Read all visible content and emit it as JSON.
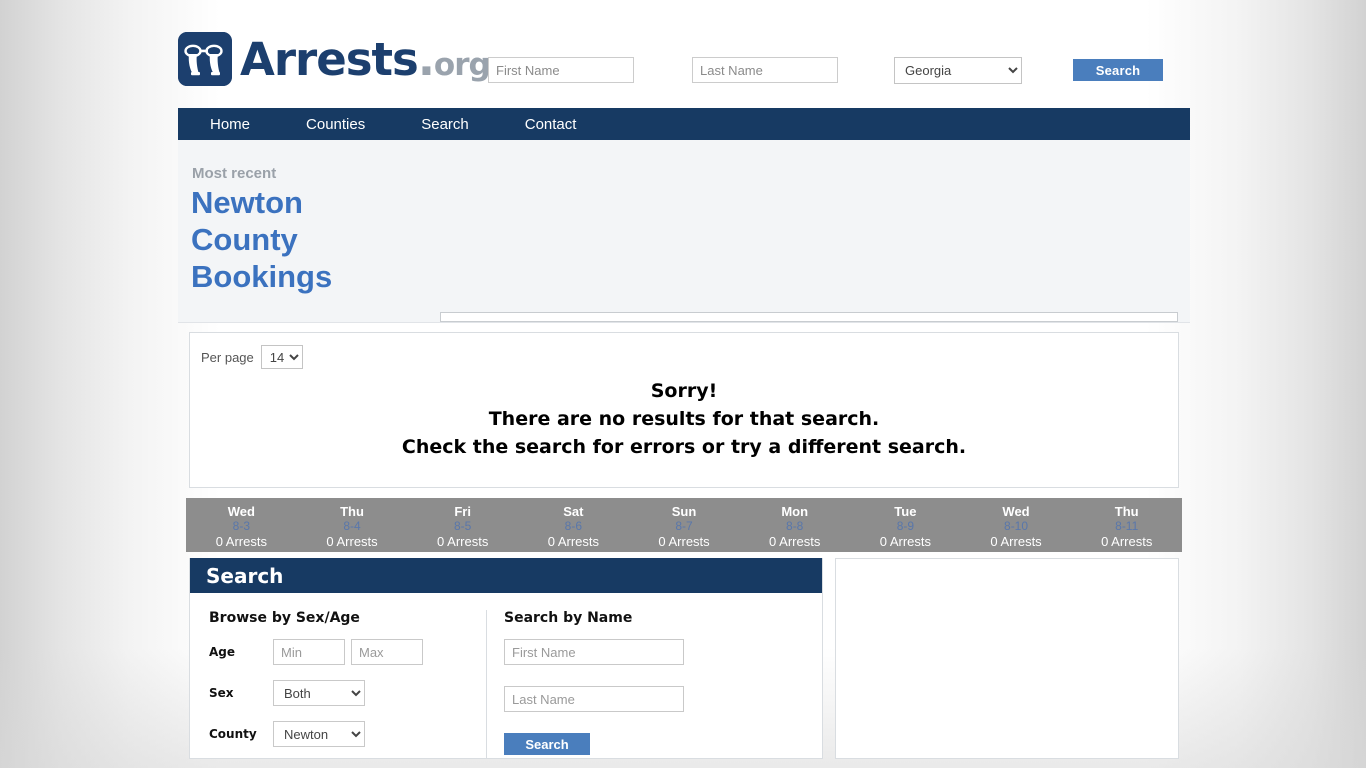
{
  "site": {
    "brand_main": "Arrests",
    "brand_dot": ".",
    "brand_org": "org",
    "logo_icon": "handcuffs-icon"
  },
  "header": {
    "first_name_placeholder": "First Name",
    "first_name_value": "",
    "last_name_placeholder": "Last Name",
    "last_name_value": "",
    "state_selected": "Georgia",
    "search_label": "Search"
  },
  "nav": {
    "items": [
      {
        "label": "Home"
      },
      {
        "label": "Counties"
      },
      {
        "label": "Search"
      },
      {
        "label": "Contact"
      }
    ]
  },
  "hero": {
    "eyebrow": "Most recent",
    "title": "Newton County Bookings"
  },
  "results": {
    "per_page_label": "Per page",
    "per_page_value": "14",
    "message_line1": "Sorry!",
    "message_line2": "There are no results for that search.",
    "message_line3": "Check the search for errors or try a different search."
  },
  "days": [
    {
      "dow": "Wed",
      "date": "8-3",
      "count": "0 Arrests"
    },
    {
      "dow": "Thu",
      "date": "8-4",
      "count": "0 Arrests"
    },
    {
      "dow": "Fri",
      "date": "8-5",
      "count": "0 Arrests"
    },
    {
      "dow": "Sat",
      "date": "8-6",
      "count": "0 Arrests"
    },
    {
      "dow": "Sun",
      "date": "8-7",
      "count": "0 Arrests"
    },
    {
      "dow": "Mon",
      "date": "8-8",
      "count": "0 Arrests"
    },
    {
      "dow": "Tue",
      "date": "8-9",
      "count": "0 Arrests"
    },
    {
      "dow": "Wed",
      "date": "8-10",
      "count": "0 Arrests"
    },
    {
      "dow": "Thu",
      "date": "8-11",
      "count": "0 Arrests"
    }
  ],
  "search_panel": {
    "heading": "Search",
    "browse_heading": "Browse by Sex/Age",
    "age_label": "Age",
    "age_min_placeholder": "Min",
    "age_min_value": "",
    "age_max_placeholder": "Max",
    "age_max_value": "",
    "sex_label": "Sex",
    "sex_selected": "Both",
    "county_label": "County",
    "county_selected": "Newton",
    "name_heading": "Search by Name",
    "first_name_placeholder": "First Name",
    "first_name_value": "",
    "last_name_placeholder": "Last Name",
    "last_name_value": "",
    "submit_label": "Search"
  },
  "colors": {
    "navy": "#173a63",
    "brand_blue": "#1c3f6e",
    "accent_blue": "#4a7ebd",
    "title_blue": "#3b72bf",
    "daystrip_gray": "#8d8d8d",
    "date_blue": "#5977ab"
  }
}
